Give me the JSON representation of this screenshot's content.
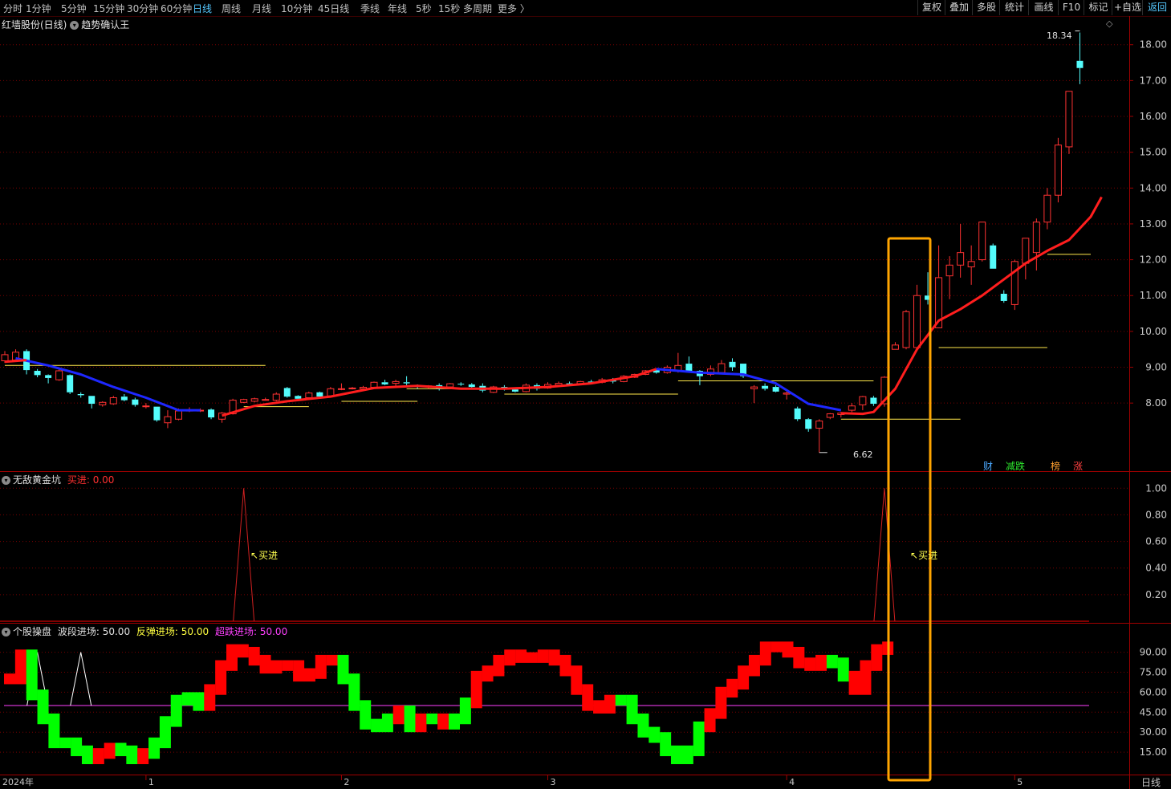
{
  "toolbar": {
    "tabs": [
      "分时",
      "1分钟",
      "5分钟",
      "15分钟",
      "30分钟",
      "60分钟",
      "日线",
      "周线",
      "月线",
      "10分钟",
      "45日线",
      "季线",
      "年线",
      "5秒",
      "15秒",
      "多周期",
      "更多 〉"
    ],
    "active_tab": "日线",
    "right_buttons": [
      "复权",
      "叠加",
      "多股",
      "统计",
      "画线",
      "F10",
      "标记",
      "+自选",
      "返回"
    ]
  },
  "main_panel": {
    "stock_title": "红墙股份(日线)",
    "indicator_name": "趋势确认王",
    "high_label": "18.34",
    "low_label": "6.62",
    "price_axis": [
      "18.00",
      "17.00",
      "16.00",
      "15.00",
      "14.00",
      "13.00",
      "12.00",
      "11.00",
      "10.00",
      "9.00",
      "8.00"
    ],
    "tags": [
      {
        "text": "财",
        "color": "#4aa8ff"
      },
      {
        "text": "减跌",
        "color": "#2ee82e"
      },
      {
        "text": "榜",
        "color": "#ffa030"
      },
      {
        "text": "涨",
        "color": "#ff4040"
      }
    ]
  },
  "sub_panel_1": {
    "name": "无敌黄金坑",
    "value_label": "买进",
    "value": "0.00",
    "signal_label": "买进",
    "axis": [
      "1.00",
      "0.80",
      "0.60",
      "0.40",
      "0.20"
    ]
  },
  "sub_panel_2": {
    "name": "个股操盘",
    "items": [
      {
        "label": "波段进场",
        "value": "50.00",
        "color": "#e0e0e0"
      },
      {
        "label": "反弹进场",
        "value": "50.00",
        "color": "#ffff40"
      },
      {
        "label": "超跌进场",
        "value": "50.00",
        "color": "#ff40ff"
      }
    ],
    "axis": [
      "90.00",
      "75.00",
      "60.00",
      "45.00",
      "30.00",
      "15.00"
    ]
  },
  "time_axis": [
    "2024年",
    "1",
    "2",
    "3",
    "4",
    "5"
  ],
  "period_label": "日线",
  "colors": {
    "up": "#ff3232",
    "down": "#54fcfc",
    "trend_up": "#ff1e1e",
    "trend_down": "#1e28ff",
    "grid": "#7a0000",
    "border": "#a00000",
    "axis_text": "#c8c8c8",
    "support": "#ffe84a",
    "highlight": "#ffa500",
    "osc_up": "#ff0000",
    "osc_down": "#00ff00",
    "base_line": "#ff40ff"
  },
  "chart_data": {
    "type": "candlestick",
    "period": "daily",
    "candles": [
      {
        "o": 9.18,
        "h": 9.45,
        "l": 9.12,
        "c": 9.35
      },
      {
        "o": 9.2,
        "h": 9.5,
        "l": 9.15,
        "c": 9.42
      },
      {
        "o": 9.45,
        "h": 9.5,
        "l": 8.8,
        "c": 8.92
      },
      {
        "o": 8.9,
        "h": 8.95,
        "l": 8.72,
        "c": 8.78
      },
      {
        "o": 8.78,
        "h": 8.8,
        "l": 8.55,
        "c": 8.7
      },
      {
        "o": 8.65,
        "h": 8.95,
        "l": 8.62,
        "c": 8.9
      },
      {
        "o": 8.78,
        "h": 8.8,
        "l": 8.25,
        "c": 8.3
      },
      {
        "o": 8.25,
        "h": 8.3,
        "l": 8.15,
        "c": 8.22
      },
      {
        "o": 8.2,
        "h": 8.2,
        "l": 7.85,
        "c": 7.98
      },
      {
        "o": 7.95,
        "h": 8.05,
        "l": 7.9,
        "c": 8.02
      },
      {
        "o": 7.98,
        "h": 8.2,
        "l": 7.95,
        "c": 8.15
      },
      {
        "o": 8.18,
        "h": 8.25,
        "l": 8.05,
        "c": 8.08
      },
      {
        "o": 8.1,
        "h": 8.15,
        "l": 7.9,
        "c": 7.95
      },
      {
        "o": 7.92,
        "h": 8.0,
        "l": 7.85,
        "c": 7.92
      },
      {
        "o": 7.9,
        "h": 7.9,
        "l": 7.48,
        "c": 7.52
      },
      {
        "o": 7.45,
        "h": 7.8,
        "l": 7.3,
        "c": 7.62
      },
      {
        "o": 7.55,
        "h": 7.85,
        "l": 7.52,
        "c": 7.78
      },
      {
        "o": 7.8,
        "h": 7.88,
        "l": 7.75,
        "c": 7.8
      },
      {
        "o": 7.78,
        "h": 7.85,
        "l": 7.75,
        "c": 7.8
      },
      {
        "o": 7.82,
        "h": 7.85,
        "l": 7.55,
        "c": 7.6
      },
      {
        "o": 7.55,
        "h": 7.75,
        "l": 7.45,
        "c": 7.72
      },
      {
        "o": 7.7,
        "h": 8.12,
        "l": 7.68,
        "c": 8.08
      },
      {
        "o": 8.02,
        "h": 8.12,
        "l": 8.0,
        "c": 8.1
      },
      {
        "o": 8.05,
        "h": 8.15,
        "l": 8.02,
        "c": 8.12
      },
      {
        "o": 8.1,
        "h": 8.15,
        "l": 8.08,
        "c": 8.1
      },
      {
        "o": 8.08,
        "h": 8.3,
        "l": 8.05,
        "c": 8.25
      },
      {
        "o": 8.42,
        "h": 8.45,
        "l": 8.15,
        "c": 8.18
      },
      {
        "o": 8.2,
        "h": 8.22,
        "l": 8.1,
        "c": 8.12
      },
      {
        "o": 8.15,
        "h": 8.32,
        "l": 8.12,
        "c": 8.28
      },
      {
        "o": 8.3,
        "h": 8.32,
        "l": 8.15,
        "c": 8.18
      },
      {
        "o": 8.2,
        "h": 8.45,
        "l": 8.18,
        "c": 8.4
      },
      {
        "o": 8.38,
        "h": 8.55,
        "l": 8.36,
        "c": 8.4
      },
      {
        "o": 8.4,
        "h": 8.45,
        "l": 8.38,
        "c": 8.42
      },
      {
        "o": 8.4,
        "h": 8.48,
        "l": 8.36,
        "c": 8.44
      },
      {
        "o": 8.44,
        "h": 8.6,
        "l": 8.42,
        "c": 8.58
      },
      {
        "o": 8.58,
        "h": 8.65,
        "l": 8.5,
        "c": 8.52
      },
      {
        "o": 8.55,
        "h": 8.65,
        "l": 8.45,
        "c": 8.6
      },
      {
        "o": 8.58,
        "h": 8.75,
        "l": 8.5,
        "c": 8.55
      },
      {
        "o": 8.5,
        "h": 8.52,
        "l": 8.4,
        "c": 8.45
      },
      {
        "o": 8.45,
        "h": 8.5,
        "l": 8.4,
        "c": 8.48
      },
      {
        "o": 8.5,
        "h": 8.55,
        "l": 8.35,
        "c": 8.4
      },
      {
        "o": 8.45,
        "h": 8.56,
        "l": 8.42,
        "c": 8.54
      },
      {
        "o": 8.54,
        "h": 8.58,
        "l": 8.48,
        "c": 8.52
      },
      {
        "o": 8.52,
        "h": 8.56,
        "l": 8.4,
        "c": 8.45
      },
      {
        "o": 8.48,
        "h": 8.55,
        "l": 8.3,
        "c": 8.35
      },
      {
        "o": 8.3,
        "h": 8.48,
        "l": 8.28,
        "c": 8.45
      },
      {
        "o": 8.45,
        "h": 8.5,
        "l": 8.35,
        "c": 8.38
      },
      {
        "o": 8.38,
        "h": 8.42,
        "l": 8.3,
        "c": 8.32
      },
      {
        "o": 8.32,
        "h": 8.55,
        "l": 8.3,
        "c": 8.5
      },
      {
        "o": 8.5,
        "h": 8.55,
        "l": 8.35,
        "c": 8.4
      },
      {
        "o": 8.42,
        "h": 8.58,
        "l": 8.4,
        "c": 8.52
      },
      {
        "o": 8.5,
        "h": 8.6,
        "l": 8.45,
        "c": 8.55
      },
      {
        "o": 8.55,
        "h": 8.6,
        "l": 8.5,
        "c": 8.52
      },
      {
        "o": 8.52,
        "h": 8.62,
        "l": 8.5,
        "c": 8.6
      },
      {
        "o": 8.6,
        "h": 8.65,
        "l": 8.55,
        "c": 8.58
      },
      {
        "o": 8.58,
        "h": 8.7,
        "l": 8.55,
        "c": 8.65
      },
      {
        "o": 8.65,
        "h": 8.7,
        "l": 8.55,
        "c": 8.6
      },
      {
        "o": 8.6,
        "h": 8.78,
        "l": 8.58,
        "c": 8.75
      },
      {
        "o": 8.72,
        "h": 8.82,
        "l": 8.7,
        "c": 8.8
      },
      {
        "o": 8.8,
        "h": 8.92,
        "l": 8.78,
        "c": 8.9
      },
      {
        "o": 8.92,
        "h": 8.95,
        "l": 8.82,
        "c": 8.85
      },
      {
        "o": 8.85,
        "h": 9.05,
        "l": 8.82,
        "c": 9.0
      },
      {
        "o": 8.9,
        "h": 9.4,
        "l": 8.85,
        "c": 9.05
      },
      {
        "o": 9.1,
        "h": 9.3,
        "l": 8.85,
        "c": 8.9
      },
      {
        "o": 8.9,
        "h": 8.92,
        "l": 8.5,
        "c": 8.75
      },
      {
        "o": 8.8,
        "h": 9.05,
        "l": 8.75,
        "c": 8.95
      },
      {
        "o": 8.85,
        "h": 9.2,
        "l": 8.8,
        "c": 9.1
      },
      {
        "o": 9.15,
        "h": 9.25,
        "l": 8.9,
        "c": 9.0
      },
      {
        "o": 9.1,
        "h": 9.1,
        "l": 8.7,
        "c": 8.75
      },
      {
        "o": 8.4,
        "h": 8.5,
        "l": 8.0,
        "c": 8.45
      },
      {
        "o": 8.48,
        "h": 8.55,
        "l": 8.35,
        "c": 8.4
      },
      {
        "o": 8.45,
        "h": 8.5,
        "l": 8.3,
        "c": 8.32
      },
      {
        "o": 8.25,
        "h": 8.32,
        "l": 8.1,
        "c": 8.28
      },
      {
        "o": 7.85,
        "h": 7.9,
        "l": 7.5,
        "c": 7.55
      },
      {
        "o": 7.55,
        "h": 7.58,
        "l": 7.2,
        "c": 7.28
      },
      {
        "o": 7.3,
        "h": 7.55,
        "l": 6.62,
        "c": 7.5
      },
      {
        "o": 7.6,
        "h": 7.72,
        "l": 7.55,
        "c": 7.7
      },
      {
        "o": 7.68,
        "h": 7.75,
        "l": 7.6,
        "c": 7.72
      },
      {
        "o": 7.8,
        "h": 8.0,
        "l": 7.75,
        "c": 7.92
      },
      {
        "o": 7.95,
        "h": 8.2,
        "l": 7.8,
        "c": 8.18
      },
      {
        "o": 8.15,
        "h": 8.2,
        "l": 7.92,
        "c": 7.98
      },
      {
        "o": 7.98,
        "h": 8.75,
        "l": 7.9,
        "c": 8.72
      },
      {
        "o": 9.5,
        "h": 9.7,
        "l": 9.5,
        "c": 9.62
      },
      {
        "o": 9.55,
        "h": 10.6,
        "l": 9.5,
        "c": 10.55
      },
      {
        "o": 9.55,
        "h": 11.3,
        "l": 9.5,
        "c": 11.0
      },
      {
        "o": 11.0,
        "h": 11.65,
        "l": 10.75,
        "c": 10.88
      },
      {
        "o": 10.1,
        "h": 12.4,
        "l": 10.1,
        "c": 11.5
      },
      {
        "o": 11.55,
        "h": 12.1,
        "l": 10.9,
        "c": 11.85
      },
      {
        "o": 11.85,
        "h": 13.0,
        "l": 11.5,
        "c": 12.2
      },
      {
        "o": 11.8,
        "h": 12.4,
        "l": 11.3,
        "c": 11.95
      },
      {
        "o": 12.0,
        "h": 13.05,
        "l": 11.95,
        "c": 13.05
      },
      {
        "o": 12.4,
        "h": 12.45,
        "l": 11.75,
        "c": 11.75
      },
      {
        "o": 11.05,
        "h": 11.15,
        "l": 10.8,
        "c": 10.85
      },
      {
        "o": 10.75,
        "h": 12.0,
        "l": 10.6,
        "c": 11.95
      },
      {
        "o": 11.9,
        "h": 12.5,
        "l": 11.45,
        "c": 12.6
      },
      {
        "o": 12.2,
        "h": 13.15,
        "l": 11.7,
        "c": 13.05
      },
      {
        "o": 13.05,
        "h": 14.0,
        "l": 12.85,
        "c": 13.8
      },
      {
        "o": 13.8,
        "h": 15.4,
        "l": 13.6,
        "c": 15.2
      },
      {
        "o": 15.15,
        "h": 16.7,
        "l": 14.95,
        "c": 16.7
      },
      {
        "o": 17.55,
        "h": 18.34,
        "l": 16.9,
        "c": 17.35
      }
    ],
    "trend_line": {
      "down_segments": [
        [
          [
            1,
            9.25
          ],
          [
            4,
            9.05
          ],
          [
            7,
            8.8
          ],
          [
            10,
            8.45
          ],
          [
            13,
            8.15
          ],
          [
            16,
            7.8
          ],
          [
            18,
            7.8
          ]
        ],
        [
          [
            60,
            8.95
          ],
          [
            64,
            8.85
          ],
          [
            68,
            8.8
          ],
          [
            71,
            8.55
          ],
          [
            74,
            7.98
          ],
          [
            77,
            7.8
          ]
        ]
      ],
      "up_segments": [
        [
          [
            0,
            9.15
          ],
          [
            2,
            9.2
          ]
        ],
        [
          [
            20,
            7.65
          ],
          [
            23,
            7.92
          ],
          [
            26,
            8.05
          ],
          [
            30,
            8.18
          ],
          [
            34,
            8.42
          ],
          [
            38,
            8.48
          ],
          [
            42,
            8.4
          ],
          [
            46,
            8.4
          ],
          [
            50,
            8.45
          ],
          [
            54,
            8.55
          ],
          [
            58,
            8.75
          ],
          [
            60,
            8.95
          ]
        ],
        [
          [
            77,
            7.72
          ],
          [
            79,
            7.7
          ],
          [
            80,
            7.75
          ],
          [
            82,
            8.4
          ],
          [
            84,
            9.5
          ],
          [
            86,
            10.3
          ],
          [
            88,
            10.62
          ],
          [
            90,
            11.0
          ],
          [
            92,
            11.45
          ],
          [
            94,
            11.9
          ],
          [
            96,
            12.25
          ],
          [
            98,
            12.55
          ],
          [
            100,
            13.2
          ],
          [
            101,
            13.75
          ]
        ]
      ]
    },
    "support_lines": [
      {
        "from": 0,
        "to": 24,
        "y": 9.05
      },
      {
        "from": 22,
        "to": 28,
        "y": 7.9
      },
      {
        "from": 31,
        "to": 38,
        "y": 8.05
      },
      {
        "from": 37,
        "to": 48,
        "y": 8.4
      },
      {
        "from": 46,
        "to": 62,
        "y": 8.25
      },
      {
        "from": 62,
        "to": 80,
        "y": 8.62
      },
      {
        "from": 77,
        "to": 88,
        "y": 7.55
      },
      {
        "from": 86,
        "to": 96,
        "y": 9.55
      },
      {
        "from": 96,
        "to": 100,
        "y": 12.15
      }
    ],
    "sub1_peaks": [
      22,
      81
    ],
    "sub2_blocks": [
      {
        "v": 70,
        "u": 1
      },
      {
        "v": 88,
        "u": 1
      },
      {
        "v": 58,
        "u": 0
      },
      {
        "v": 40,
        "u": 0
      },
      {
        "v": 22,
        "u": 0
      },
      {
        "v": 22,
        "u": 0
      },
      {
        "v": 16,
        "u": 0
      },
      {
        "v": 10,
        "u": 0
      },
      {
        "v": 14,
        "u": 1
      },
      {
        "v": 18,
        "u": 1
      },
      {
        "v": 16,
        "u": 0
      },
      {
        "v": 10,
        "u": 0
      },
      {
        "v": 14,
        "u": 1
      },
      {
        "v": 22,
        "u": 0
      },
      {
        "v": 38,
        "u": 0
      },
      {
        "v": 54,
        "u": 0
      },
      {
        "v": 56,
        "u": 0
      },
      {
        "v": 50,
        "u": 0
      },
      {
        "v": 62,
        "u": 1
      },
      {
        "v": 80,
        "u": 1
      },
      {
        "v": 92,
        "u": 1
      },
      {
        "v": 90,
        "u": 1
      },
      {
        "v": 84,
        "u": 1
      },
      {
        "v": 78,
        "u": 1
      },
      {
        "v": 80,
        "u": 1
      },
      {
        "v": 80,
        "u": 1
      },
      {
        "v": 72,
        "u": 1
      },
      {
        "v": 74,
        "u": 1
      },
      {
        "v": 84,
        "u": 1
      },
      {
        "v": 84,
        "u": 1
      },
      {
        "v": 70,
        "u": 0
      },
      {
        "v": 50,
        "u": 0
      },
      {
        "v": 36,
        "u": 0
      },
      {
        "v": 34,
        "u": 0
      },
      {
        "v": 40,
        "u": 0
      },
      {
        "v": 46,
        "u": 1
      },
      {
        "v": 34,
        "u": 0
      },
      {
        "v": 40,
        "u": 1
      },
      {
        "v": 40,
        "u": 0
      },
      {
        "v": 36,
        "u": 1
      },
      {
        "v": 40,
        "u": 0
      },
      {
        "v": 52,
        "u": 0
      },
      {
        "v": 72,
        "u": 1
      },
      {
        "v": 76,
        "u": 1
      },
      {
        "v": 84,
        "u": 1
      },
      {
        "v": 88,
        "u": 1
      },
      {
        "v": 86,
        "u": 1
      },
      {
        "v": 86,
        "u": 1
      },
      {
        "v": 88,
        "u": 1
      },
      {
        "v": 84,
        "u": 1
      },
      {
        "v": 76,
        "u": 1
      },
      {
        "v": 62,
        "u": 1
      },
      {
        "v": 50,
        "u": 1
      },
      {
        "v": 48,
        "u": 1
      },
      {
        "v": 54,
        "u": 1
      },
      {
        "v": 54,
        "u": 0
      },
      {
        "v": 40,
        "u": 0
      },
      {
        "v": 30,
        "u": 0
      },
      {
        "v": 26,
        "u": 0
      },
      {
        "v": 16,
        "u": 0
      },
      {
        "v": 10,
        "u": 0
      },
      {
        "v": 16,
        "u": 0
      },
      {
        "v": 34,
        "u": 0
      },
      {
        "v": 44,
        "u": 1
      },
      {
        "v": 60,
        "u": 1
      },
      {
        "v": 66,
        "u": 1
      },
      {
        "v": 76,
        "u": 1
      },
      {
        "v": 84,
        "u": 1
      },
      {
        "v": 94,
        "u": 1
      },
      {
        "v": 94,
        "u": 1
      },
      {
        "v": 90,
        "u": 1
      },
      {
        "v": 82,
        "u": 1
      },
      {
        "v": 80,
        "u": 1
      },
      {
        "v": 84,
        "u": 1
      },
      {
        "v": 82,
        "u": 0
      },
      {
        "v": 72,
        "u": 0
      },
      {
        "v": 62,
        "u": 1
      },
      {
        "v": 80,
        "u": 1
      },
      {
        "v": 92,
        "u": 1
      },
      {
        "v": 94,
        "u": 1
      }
    ],
    "white_peaks": [
      3,
      7
    ],
    "highlight_box": {
      "from": 79,
      "to": 82
    },
    "price_range": [
      6.1,
      18.8
    ],
    "sub1_range": [
      0,
      1.05
    ],
    "sub2_range": [
      0,
      100
    ]
  }
}
